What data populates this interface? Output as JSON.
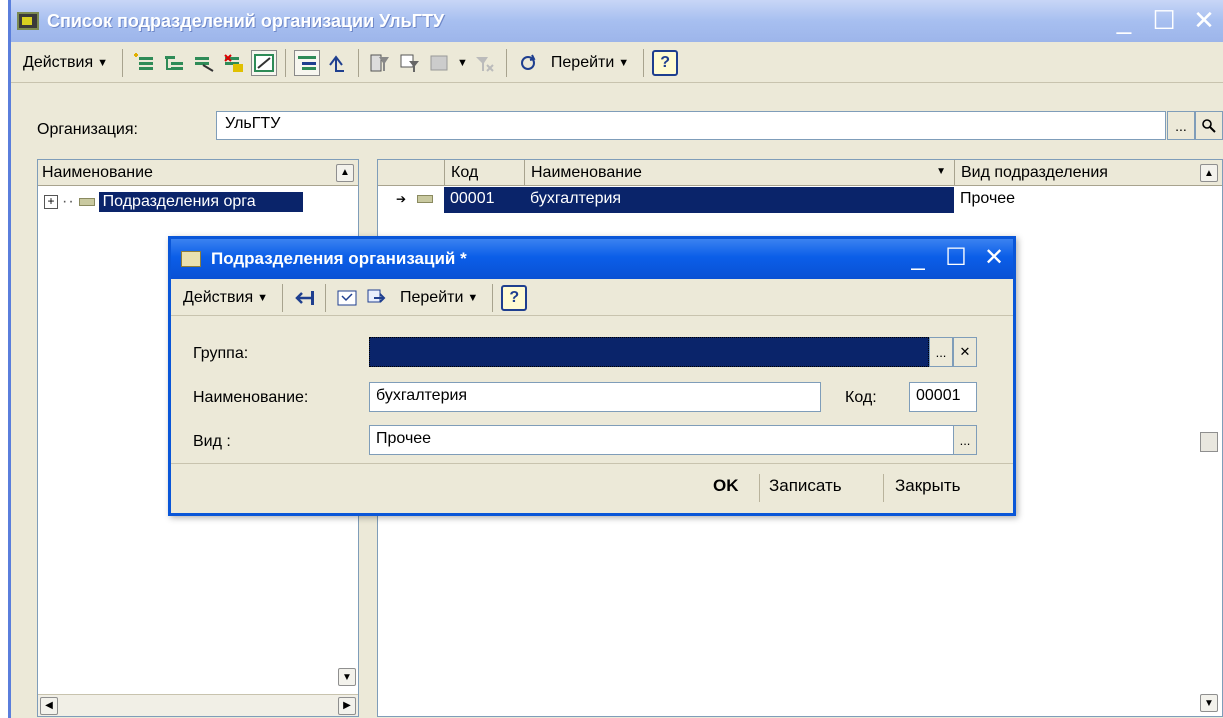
{
  "main_window": {
    "title": "Список подразделений организации УльГТУ",
    "toolbar": {
      "actions_label": "Действия",
      "goto_label": "Перейти",
      "help_label": "?"
    },
    "organization": {
      "label": "Организация:",
      "value": "УльГТУ"
    },
    "tree": {
      "header": "Наименование",
      "item_label": "Подразделения орга"
    },
    "list": {
      "columns": [
        "Код",
        "Наименование",
        "Вид подразделения"
      ],
      "rows": [
        {
          "code": "00001",
          "name": "бухгалтерия",
          "kind": "Прочее"
        }
      ]
    }
  },
  "dialog": {
    "title": "Подразделения организаций *",
    "toolbar": {
      "actions_label": "Действия",
      "goto_label": "Перейти",
      "help_label": "?"
    },
    "fields": {
      "group_label": "Группа:",
      "group_value": "",
      "name_label": "Наименование:",
      "name_value": "бухгалтерия",
      "code_label": "Код:",
      "code_value": "00001",
      "kind_label": "Вид :",
      "kind_value": "Прочее"
    },
    "buttons": {
      "ok": "OK",
      "save": "Записать",
      "close": "Закрыть"
    }
  },
  "colors": {
    "selection": "#0a246a",
    "dialog_title": "#0b5ee8",
    "inactive_title": "#a7bff0",
    "window_bg": "#ece9d8"
  }
}
